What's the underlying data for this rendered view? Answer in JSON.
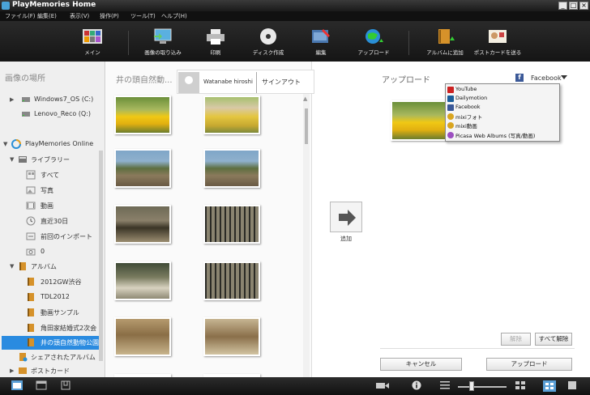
{
  "window": {
    "title": "PlayMemories Home",
    "min": "_",
    "max": "□",
    "close": "×"
  },
  "menu": [
    "ファイル(F)",
    "編集(E)",
    "表示(V)",
    "操作(P)",
    "ツール(T)",
    "ヘルプ(H)"
  ],
  "toolbar": [
    {
      "label": "メイン",
      "icon": "main-icon"
    },
    {
      "label": "画像の取り込み",
      "icon": "import-icon"
    },
    {
      "label": "印刷",
      "icon": "print-icon"
    },
    {
      "label": "ディスク作成",
      "icon": "disc-icon"
    },
    {
      "label": "編集",
      "icon": "edit-icon"
    },
    {
      "label": "アップロード",
      "icon": "upload-icon"
    },
    {
      "label": "アルバムに追加",
      "icon": "album-add-icon"
    },
    {
      "label": "ポストカードを送る",
      "icon": "postcard-icon"
    }
  ],
  "left": {
    "heading": "画像の場所",
    "drives": [
      "Windows7_OS (C:)",
      "Lenovo_Reco (Q:)"
    ],
    "online": "PlayMemories Online",
    "library": "ライブラリー",
    "library_items": [
      "すべて",
      "写真",
      "動画",
      "直近30日",
      "前回のインポート",
      "0"
    ],
    "album": "アルバム",
    "albums": [
      "2012GW渋谷",
      "TDL2012",
      "動画サンプル",
      "角田家結婚式2次会",
      "井の頭自然動物公園"
    ],
    "shared": "シェアされたアルバム",
    "postcard": "ポストカード"
  },
  "mid": {
    "title": "井の頭自然動...",
    "user": "Watanabe hiroshi",
    "signout": "サインアウト"
  },
  "add_label": "追加",
  "right": {
    "title": "アップロード",
    "service": "Facebook",
    "services": [
      "YouTube",
      "Dailymotion",
      "Facebook",
      "mixiフォト",
      "mixi動画",
      "Picasa Web Albums (写真/動画)"
    ],
    "deselect": "解除",
    "deselect_all": "すべて解除",
    "cancel": "キャンセル",
    "upload": "アップロード"
  }
}
